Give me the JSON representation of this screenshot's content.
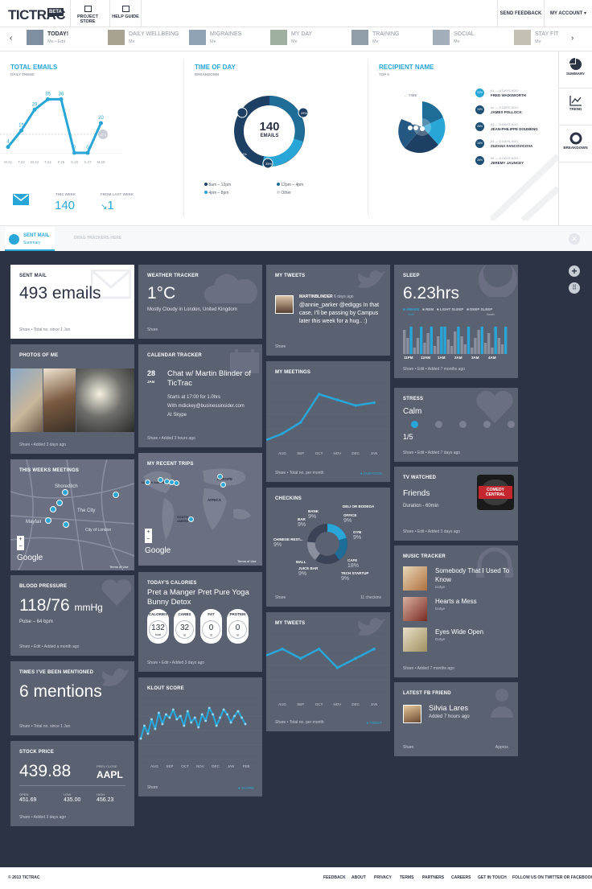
{
  "header": {
    "logo": "TICTRAC",
    "beta": "BETA",
    "project_store": "PROJECT STORE",
    "help_guide": "HELP GUIDE",
    "send_feedback": "SEND FEEDBACK",
    "my_account": "MY ACCOUNT"
  },
  "tabs": [
    {
      "title": "TODAY!",
      "sub": "Me • Edit"
    },
    {
      "title": "DAILY WELLBEING",
      "sub": "Me"
    },
    {
      "title": "MIGRAINES",
      "sub": "Me"
    },
    {
      "title": "MY DAY",
      "sub": "Me"
    },
    {
      "title": "TRAINING",
      "sub": "Me"
    },
    {
      "title": "SOCIAL",
      "sub": "Me"
    },
    {
      "title": "STAY FIT",
      "sub": "Me"
    }
  ],
  "overview": {
    "total": {
      "title": "TOTAL EMAILS",
      "sub": "DAILY TREND",
      "this_week_label": "THIS WEEK",
      "this_week": "140",
      "from_last_label": "FROM LAST WEEK",
      "from_last": "1"
    },
    "time": {
      "title": "TIME OF DAY",
      "sub": "BREAKDOWN",
      "center": "140",
      "center_label": "EMAILS",
      "legend": [
        "8am – 12pm",
        "12pm – 4pm",
        "4pm – 8pm",
        "Other"
      ],
      "pct": [
        "26%",
        "35%",
        "35%"
      ]
    },
    "recipient": {
      "title": "RECIPIENT NAME",
      "sub": "TOP 5",
      "time_label": "← TIME",
      "people": [
        {
          "pct": "12%",
          "when": "#1 — 6 DAYS AGO",
          "name": "FRED WADSWORTH"
        },
        {
          "pct": "16%",
          "when": "#2 — 5 DAYS AGO",
          "name": "JAMES POLLOCK"
        },
        {
          "pct": "28%",
          "when": "#3 — 6 DAYS AGO",
          "name": "JEAN-PHILIPPE DOUMENG"
        },
        {
          "pct": "18%",
          "when": "#4 — 6 DAYS AGO",
          "name": "ZUZANA FANCOVICOVA"
        },
        {
          "pct": "26%",
          "when": "#5 — 6 DAYS AGO",
          "name": "JEREMY JAUNCEY"
        }
      ]
    },
    "side": [
      "SUMMARY",
      "TREND",
      "BREAKDOWN"
    ]
  },
  "total_chart": {
    "x": [
      "W.21",
      "T.22",
      "W.23",
      "T.24",
      "F.25",
      "S.26",
      "S.27",
      "M.28"
    ],
    "y": [
      4,
      15,
      29,
      36,
      36,
      0,
      0,
      20
    ],
    "goal": "12.5"
  },
  "sentbar": {
    "title": "SENT MAIL",
    "sub": "Summary",
    "drag": "DRAG TRACKERS HERE"
  },
  "cards": {
    "sent": {
      "title": "SENT MAIL",
      "value": "493 emails",
      "foot": "Share  •  Total no. since 1 Jan"
    },
    "weather": {
      "title": "WEATHER TRACKER",
      "value": "1°C",
      "desc": "Mostly Cloudy in London, United Kingdom",
      "foot": "Share"
    },
    "tweets": {
      "title": "MY TWEETS",
      "user": "MARTINBLINDER",
      "ago": "6 days ago",
      "text": "@annie_parker @ediggs In that case, I'll be passing by Campus later this week for a hug.. :)",
      "foot": "Share"
    },
    "sleep": {
      "title": "SLEEP",
      "value": "6.23hrs",
      "legend": [
        "AWAKE",
        "REM",
        "LIGHT SLEEP",
        "DEEP SLEEP"
      ],
      "legend_sub": [
        "0min",
        "",
        "",
        "0umin"
      ],
      "x": [
        "11PM",
        "12AM",
        "1AM",
        "2AM",
        "3AM",
        "4AM"
      ],
      "foot": "Share  •  Edit  •  Added 7 months ago"
    },
    "photos": {
      "title": "PHOTOS OF ME",
      "foot": "Share  •  Added 3 days ago"
    },
    "calendar": {
      "title": "CALENDAR TRACKER",
      "day": "28",
      "mon": "JAN",
      "event": "Chat w/ Martin Blinder of TicTrac",
      "time": "Starts at 17:00 for 1.0hrs",
      "with": "With mdickey@businessinsider.com",
      "at": "At Skype",
      "foot": "Share  •  Added 3 hours ago"
    },
    "meetings": {
      "title": "MY MEETINGS",
      "x": [
        "AUG",
        "SEP",
        "OCT",
        "NOV",
        "DEC",
        "JAN"
      ],
      "y": [
        2,
        4,
        9,
        8,
        7,
        7.5
      ],
      "foot": "Share  •  Total no. per month",
      "tag": "DURATION"
    },
    "stress": {
      "title": "STRESS",
      "value": "Calm",
      "score": "1/5",
      "foot": "Share  •  Edit  •  Added 7 days ago"
    },
    "week_meetings": {
      "title": "THIS WEEKS MEETINGS",
      "places": [
        "Shoreditch",
        "The City",
        "City of London",
        "Mayfair"
      ],
      "google": "Google",
      "terms": "Terms of Use"
    },
    "trips": {
      "title": "MY RECENT TRIPS",
      "places": [
        "NORTH AMERICA",
        "EUROPE",
        "AFRICA",
        "SOUTH AMERICA"
      ],
      "google": "Google",
      "terms": "Terms of Use"
    },
    "checkins": {
      "title": "CHECKINS",
      "items": [
        {
          "l": "BANK",
          "v": "9%"
        },
        {
          "l": "DELI OR BODEGA",
          "v": ""
        },
        {
          "l": "OFFICE",
          "v": "9%"
        },
        {
          "l": "BAR",
          "v": "9%"
        },
        {
          "l": "GYM",
          "v": "9%"
        },
        {
          "l": "CHINESE REST...",
          "v": "9%"
        },
        {
          "l": "MALL",
          "v": ""
        },
        {
          "l": "CAFE",
          "v": "18%"
        },
        {
          "l": "JUICE BAR",
          "v": "9%"
        },
        {
          "l": "TECH STARTUP",
          "v": "9%"
        }
      ],
      "foot": "Share",
      "count": "11 checkins"
    },
    "tv": {
      "title": "TV WATCHED",
      "value": "Friends",
      "dur": "Duration - 60min",
      "logo": "COMEDY CENTRAL",
      "foot": "Share  •  Edit  •  Added 3 days ago"
    },
    "bp": {
      "title": "BLOOD PRESSURE",
      "value": "118/76",
      "unit": "mmHg",
      "pulse": "Pulse – 64 bpm",
      "foot": "Share  •  Edit  •  Added a month ago"
    },
    "calories": {
      "title": "TODAY'S CALORIES",
      "food": "Pret a Manger Pret Pure Yoga Bunny Detox",
      "pills": [
        {
          "l": "CALORIES",
          "v": "132",
          "u": "kcal"
        },
        {
          "l": "CARBS",
          "v": "32",
          "u": "g"
        },
        {
          "l": "FAT",
          "v": "0",
          "u": "g"
        },
        {
          "l": "PROTEIN",
          "v": "0",
          "u": "g"
        }
      ],
      "foot": "Share  •  Edit  •  Added 3 days ago"
    },
    "mytweets2": {
      "title": "MY TWEETS",
      "x": [
        "AUG",
        "SEP",
        "OCT",
        "NOV",
        "DEC",
        "JAN"
      ],
      "y": [
        5,
        4,
        5,
        3,
        4,
        5
      ],
      "foot": "Share  •  Total no. per month",
      "tag": "TWEET"
    },
    "music": {
      "title": "MUSIC TRACKER",
      "songs": [
        {
          "t": "Somebody That I Used To Know",
          "a": "Gotye"
        },
        {
          "t": "Hearts a Mess",
          "a": "Gotye"
        },
        {
          "t": "Eyes Wide Open",
          "a": "Gotye"
        }
      ],
      "foot": "Share  •  Added 7 months ago"
    },
    "mentions": {
      "title": "TIMES I'VE BEEN MENTIONED",
      "value": "6 mentions",
      "foot": "Share  •  Total no. since 1 Jan"
    },
    "klout": {
      "title": "KLOUT SCORE",
      "x": [
        "AUG",
        "SEP",
        "OCT",
        "NOV",
        "DEC",
        "JAN",
        "FEB"
      ],
      "foot": "Share",
      "tag": "SCORE"
    },
    "fb": {
      "title": "LATEST FB FRIEND",
      "name": "Silvia Lares",
      "ago": "Added 7 hours ago",
      "foot": "Share",
      "approx": "Approx."
    },
    "stock": {
      "title": "STOCK PRICE",
      "value": "439.88",
      "prev_label": "PREV CLOSE",
      "ticker": "AAPL",
      "open_l": "OPEN",
      "open": "451.69",
      "low_l": "LOW",
      "low": "435.00",
      "high_l": "HIGH",
      "high": "456.23",
      "foot": "Share  •  Added 3 days ago"
    }
  },
  "footer": {
    "copy": "© 2013 TICTRAC",
    "links": [
      "FEEDBACK",
      "ABOUT",
      "PRIVACY",
      "TERMS",
      "PARTNERS",
      "CAREERS",
      "GET IN TOUCH",
      "FOLLOW US ON TWITTER OR FACEBOOK"
    ]
  }
}
